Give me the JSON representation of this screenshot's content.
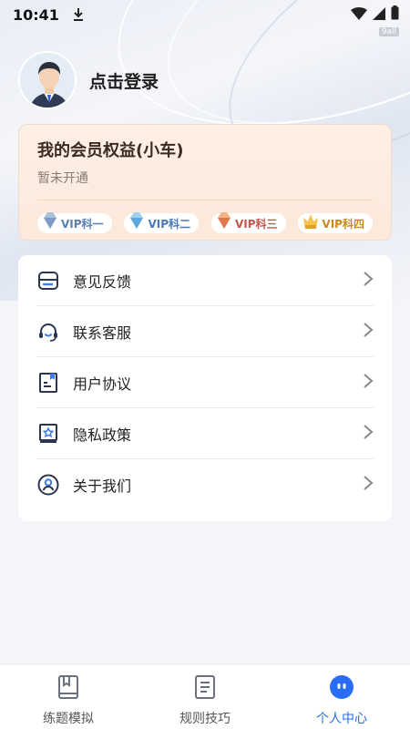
{
  "status_bar": {
    "time": "10:41",
    "sub_label": "9all"
  },
  "profile": {
    "login_label": "点击登录"
  },
  "vip": {
    "title": "我的会员权益(小车)",
    "subtitle": "暂未开通",
    "badges": [
      {
        "label": "VIP科一",
        "color": "#5a7fb0"
      },
      {
        "label": "VIP科二",
        "color": "#4a78b8"
      },
      {
        "label": "VIP科三",
        "color": "#c9534a"
      },
      {
        "label": "VIP科四",
        "color": "#c98a1a"
      }
    ]
  },
  "menu": {
    "items": [
      {
        "label": "意见反馈",
        "icon": "feedback-icon"
      },
      {
        "label": "联系客服",
        "icon": "headset-icon"
      },
      {
        "label": "用户协议",
        "icon": "agreement-icon"
      },
      {
        "label": "隐私政策",
        "icon": "privacy-icon"
      },
      {
        "label": "关于我们",
        "icon": "user-circle-icon"
      }
    ]
  },
  "tabbar": {
    "tabs": [
      {
        "label": "练题模拟",
        "icon": "book-icon",
        "active": false
      },
      {
        "label": "规则技巧",
        "icon": "document-icon",
        "active": false
      },
      {
        "label": "个人中心",
        "icon": "profile-face-icon",
        "active": true
      }
    ]
  },
  "colors": {
    "accent": "#2a6df5",
    "icon_dark": "#2c3550",
    "icon_accent": "#3b7cf6"
  }
}
